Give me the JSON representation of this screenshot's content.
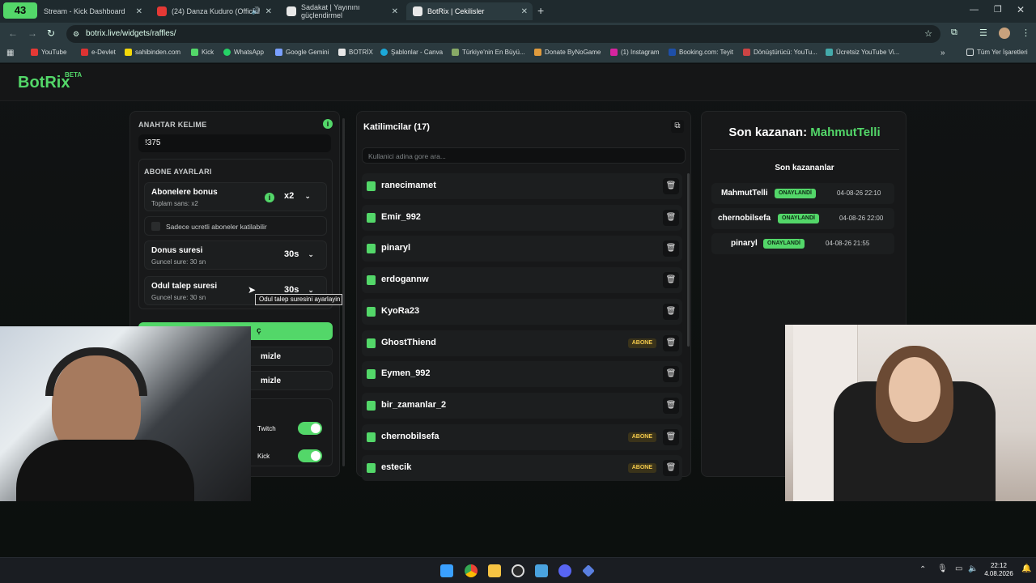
{
  "browser": {
    "tabs": [
      {
        "label": "Stream - Kick Dashboard",
        "badge": "43"
      },
      {
        "label": "(24) Danza Kuduro (Official"
      },
      {
        "label": "Sadakat | Yayınını güçlendirmel"
      },
      {
        "label": "BotRix | Cekilisler"
      }
    ],
    "url": "botrix.live/widgets/raffles/",
    "bookmarks": [
      "YouTube",
      "e-Devlet",
      "sahibinden.com",
      "Kick",
      "WhatsApp",
      "Google Gemini",
      "BOTRİX",
      "Şablonlar - Canva",
      "Türkiye'nin En Büyü...",
      "Donate ByNoGame",
      "(1) Instagram",
      "Booking.com: Teyit",
      "Dönüştürücü: YouTu...",
      "Ücretsiz YouTube Vi...",
      "Tüm Yer İşaretleri"
    ]
  },
  "app": {
    "logo": "BotRix",
    "beta": "BETA",
    "settings": {
      "keyword_label": "ANAHTAR KELIME",
      "keyword_value": "!375",
      "sub_settings_label": "ABONE AYARLARI",
      "sub_bonus_title": "Abonelere bonus",
      "sub_bonus_sub": "Toplam sans: x2",
      "sub_bonus_value": "x2",
      "only_paid_label": "Sadece ucretli aboneler katilabilir",
      "bonus_time_title": "Donus suresi",
      "bonus_time_sub": "Guncel sure: 30 sn",
      "bonus_time_value": "30s",
      "claim_time_title": "Odul talep suresi",
      "claim_time_sub": "Guncel sure: 30 sn",
      "claim_time_value": "30s",
      "tooltip": "Odul talep suresini ayarlayin",
      "pick_button": "ç",
      "clear_button_1": "mizle",
      "clear_button_2": "mizle",
      "platform_twitch": "Twitch",
      "platform_kick": "Kick"
    },
    "participants": {
      "title": "Katilimcilar (17)",
      "search_placeholder": "Kullanici adina gore ara...",
      "badge_label": "ABONE",
      "list": [
        {
          "name": "ranecimamet",
          "sub": false
        },
        {
          "name": "Emir_992",
          "sub": false
        },
        {
          "name": "pinaryl",
          "sub": false
        },
        {
          "name": "erdogannw",
          "sub": false
        },
        {
          "name": "KyoRa23",
          "sub": false
        },
        {
          "name": "GhostThiend",
          "sub": true
        },
        {
          "name": "Eymen_992",
          "sub": false
        },
        {
          "name": "bir_zamanlar_2",
          "sub": false
        },
        {
          "name": "chernobilsefa",
          "sub": true
        },
        {
          "name": "estecik",
          "sub": true
        }
      ]
    },
    "winners": {
      "last_winner_label": "Son kazanan:",
      "last_winner_name": "MahmutTelli",
      "recent_title": "Son kazananlar",
      "status_label": "ONAYLANDİ",
      "list": [
        {
          "name": "MahmutTelli",
          "date": "04-08-26 22:10"
        },
        {
          "name": "chernobilsefa",
          "date": "04-08-26 22:00"
        },
        {
          "name": "pinaryl",
          "date": "04-08-26 21:55"
        }
      ]
    }
  },
  "taskbar": {
    "time": "22:12",
    "date": "4.08.2026"
  }
}
